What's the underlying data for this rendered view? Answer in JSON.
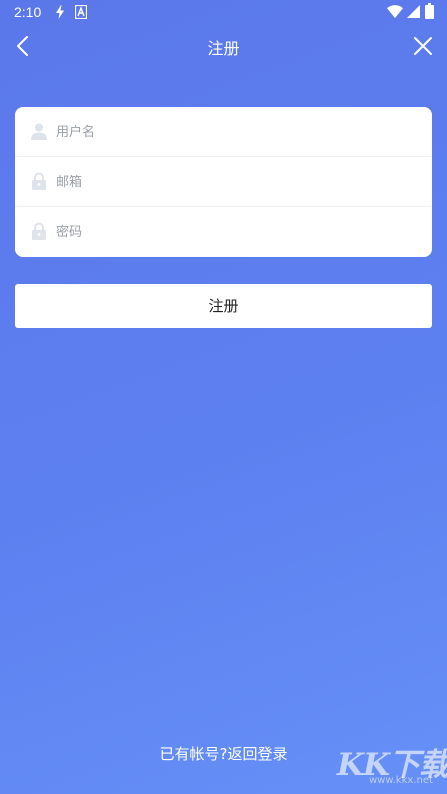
{
  "status_bar": {
    "time": "2:10",
    "icons": [
      "flash-icon",
      "accessibility-icon",
      "wifi-icon",
      "signal-icon",
      "battery-icon"
    ]
  },
  "header": {
    "title": "注册",
    "back_icon": "back-arrow-icon",
    "close_icon": "close-icon"
  },
  "form": {
    "fields": [
      {
        "name": "username",
        "placeholder": "用户名",
        "icon": "user-icon"
      },
      {
        "name": "email",
        "placeholder": "邮箱",
        "icon": "lock-icon"
      },
      {
        "name": "password",
        "placeholder": "密码",
        "icon": "lock-icon"
      }
    ]
  },
  "register_button": {
    "label": "注册"
  },
  "footer": {
    "login_link": "已有帐号?返回登录"
  },
  "watermark": {
    "brand": "KK下载",
    "url": "www.kkx.net"
  },
  "colors": {
    "background_start": "#5b78ea",
    "background_end": "#6690f7",
    "card": "#ffffff",
    "placeholder": "#9aa0a8",
    "icon": "#dfe3ec"
  }
}
